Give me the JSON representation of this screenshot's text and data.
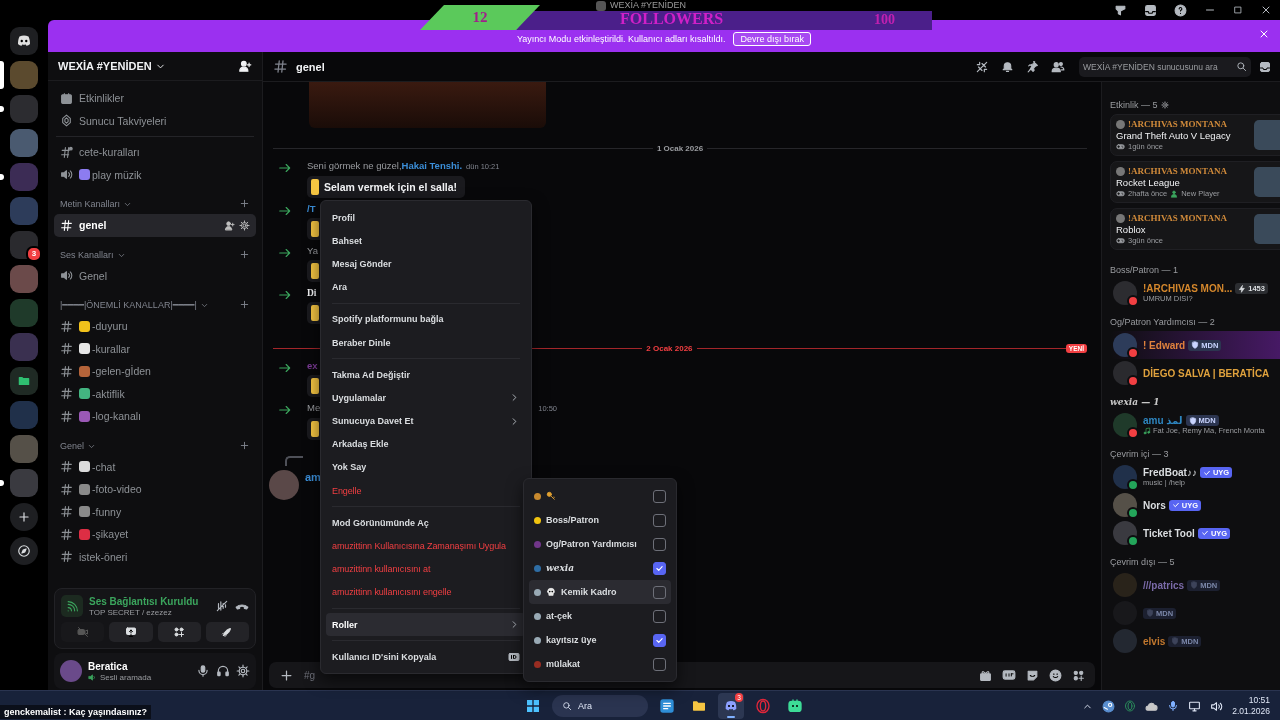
{
  "window": {
    "title": "WEXİA #YENİDEN"
  },
  "stream_overlay": {
    "left_count": "12",
    "label": "FOLLOWERS",
    "right_count": "100",
    "chat_line": "genckemalist : Kaç yaşındasınız?"
  },
  "banner": {
    "text": "Yayıncı Modu etkinleştirildi. Kullanıcı adları kısaltıldı.",
    "button": "Devre dışı bırak"
  },
  "server_rail": [
    {
      "kind": "home",
      "selected": false,
      "unread": false
    },
    {
      "kind": "server",
      "selected": true,
      "unread": false
    },
    {
      "kind": "server",
      "selected": false,
      "unread": true
    },
    {
      "kind": "server",
      "selected": false,
      "unread": false
    },
    {
      "kind": "server",
      "selected": false,
      "unread": true
    },
    {
      "kind": "server",
      "selected": false,
      "unread": false
    },
    {
      "kind": "server",
      "selected": false,
      "unread": false,
      "badge": "3"
    },
    {
      "kind": "server",
      "selected": false,
      "unread": false
    },
    {
      "kind": "server",
      "selected": false,
      "unread": false
    },
    {
      "kind": "server",
      "selected": false,
      "unread": false
    },
    {
      "kind": "folder",
      "selected": false,
      "unread": false
    },
    {
      "kind": "server",
      "selected": false,
      "unread": false
    },
    {
      "kind": "server",
      "selected": false,
      "unread": false
    },
    {
      "kind": "server",
      "selected": false,
      "unread": true
    },
    {
      "kind": "add",
      "selected": false,
      "unread": false
    },
    {
      "kind": "discover",
      "selected": false,
      "unread": false
    }
  ],
  "sidebar": {
    "server_name": "WEXİA #YENİDEN",
    "shortcuts": [
      {
        "kind": "events",
        "label": "Etkinlikler"
      },
      {
        "kind": "boosts",
        "label": "Sunucu Takviyeleri"
      }
    ],
    "channels": [
      {
        "kind": "rules",
        "label": "cete-kuralları",
        "selected": false
      },
      {
        "kind": "voice",
        "label": "play müzik",
        "color": "#8c7cf0",
        "selected": false
      }
    ],
    "categories": [
      {
        "label": "Metin Kanalları",
        "channels": [
          {
            "kind": "text",
            "label": "genel",
            "selected": true
          }
        ]
      },
      {
        "label": "Ses Kanalları",
        "channels": [
          {
            "kind": "voice",
            "label": "Genel",
            "selected": false
          }
        ]
      },
      {
        "label": "|━━━━|ÖNEMLİ KANALLAR|━━━━|",
        "channels": [
          {
            "kind": "text",
            "label": "-duyuru",
            "color": "#f2c21b",
            "selected": false
          },
          {
            "kind": "text",
            "label": "-kurallar",
            "color": "#e6e6e6",
            "selected": false
          },
          {
            "kind": "text",
            "label": "-gelen-gİden",
            "color": "#b5643a",
            "selected": false
          },
          {
            "kind": "text",
            "label": "-aktiflik",
            "color": "#43b581",
            "selected": false
          },
          {
            "kind": "text",
            "label": "-log-kanalı",
            "color": "#9b59b6",
            "selected": false
          }
        ]
      },
      {
        "label": "Genel",
        "channels": [
          {
            "kind": "text",
            "label": "-chat",
            "color": "#dcdcdc",
            "selected": false
          },
          {
            "kind": "text",
            "label": "-foto-video",
            "color": "#8a8a8a",
            "selected": false
          },
          {
            "kind": "text",
            "label": "-funny",
            "color": "#8a8a8a",
            "selected": false
          },
          {
            "kind": "text",
            "label": "-şikayet",
            "color": "#dd2e44",
            "selected": false
          },
          {
            "kind": "text",
            "label": "istek-öneri",
            "selected": false
          }
        ]
      }
    ]
  },
  "voice_panel": {
    "status": "Ses Bağlantısı Kuruldu",
    "channel": "TOP SECRET / ezezez"
  },
  "user_panel": {
    "name": "Beratica",
    "status": "Sesli aramada"
  },
  "chat": {
    "channel": "genel",
    "search_placeholder": "WEXİA #YENİDEN sunucusunu ara",
    "composer_placeholder": "#g",
    "messages": [
      {
        "kind": "image"
      },
      {
        "kind": "date",
        "label": "1 Ocak 2026",
        "new": false
      },
      {
        "kind": "join",
        "text": "Seni görmek ne güzel, ",
        "mention": "Hakai Tenshi.",
        "color": "#3b8ed8",
        "time": "dün 10:21",
        "button": "Selam vermek için el salla!"
      },
      {
        "kind": "join",
        "mention": "/T",
        "color": "#3b8ed8"
      },
      {
        "kind": "join",
        "text": "Ya",
        "bold": false
      },
      {
        "kind": "join",
        "text": "Di",
        "bold": true
      },
      {
        "kind": "date",
        "label": "2 Ocak 2026",
        "new": true,
        "badge": "YENİ"
      },
      {
        "kind": "join",
        "mention": "ex",
        "color": "#7d3c98"
      },
      {
        "kind": "join",
        "text": "Me",
        "bold": false,
        "time": "10:50"
      },
      {
        "kind": "reply",
        "mention": "am",
        "color": "#3b8ed8"
      }
    ]
  },
  "context_menu": [
    {
      "kind": "item",
      "label": "Profil",
      "selected": false
    },
    {
      "kind": "item",
      "label": "Bahset",
      "selected": false
    },
    {
      "kind": "item",
      "label": "Mesaj Gönder",
      "selected": false
    },
    {
      "kind": "item",
      "label": "Ara",
      "selected": false
    },
    {
      "kind": "separator"
    },
    {
      "kind": "item",
      "label": "Spotify platformunu bağla",
      "selected": false
    },
    {
      "kind": "item",
      "label": "Beraber Dinle",
      "selected": false
    },
    {
      "kind": "separator"
    },
    {
      "kind": "item",
      "label": "Takma Ad Değiştir",
      "selected": false
    },
    {
      "kind": "submenu",
      "label": "Uygulamalar",
      "selected": false
    },
    {
      "kind": "submenu",
      "label": "Sunucuya Davet Et",
      "selected": false
    },
    {
      "kind": "item",
      "label": "Arkadaş Ekle",
      "selected": false
    },
    {
      "kind": "item",
      "label": "Yok Say",
      "selected": false
    },
    {
      "kind": "danger",
      "label": "Engelle",
      "selected": false
    },
    {
      "kind": "separator"
    },
    {
      "kind": "item",
      "label": "Mod Görünümünde Aç",
      "selected": false
    },
    {
      "kind": "danger",
      "label": "amuzittinn Kullanıcısına Zamanaşımı Uygula",
      "selected": false
    },
    {
      "kind": "danger",
      "label": "amuzittinn kullanıcısını at",
      "selected": false
    },
    {
      "kind": "danger",
      "label": "amuzittinn kullanıcısını engelle",
      "selected": false
    },
    {
      "kind": "separator"
    },
    {
      "kind": "submenu",
      "label": "Roller",
      "selected": true
    },
    {
      "kind": "separator"
    },
    {
      "kind": "copy_id",
      "label": "Kullanıcı ID'sini Kopyala",
      "selected": false
    }
  ],
  "roles_menu": [
    {
      "kind": "icon",
      "color": "#c7892e",
      "checked": false,
      "selected": false
    },
    {
      "kind": "text",
      "label": "Boss/Patron",
      "color": "#f1c40f",
      "checked": false,
      "selected": false
    },
    {
      "kind": "text",
      "label": "Og/Patron Yardımcısı",
      "color": "#71368a",
      "checked": false,
      "selected": false
    },
    {
      "kind": "fancy",
      "label": "wexia",
      "color": "#2e6da4",
      "checked": true,
      "selected": false
    },
    {
      "kind": "icon_text",
      "label": "Kemik Kadro",
      "color": "#99aab5",
      "checked": false,
      "selected": true
    },
    {
      "kind": "text",
      "label": "at-çek",
      "color": "#99aab5",
      "checked": false,
      "selected": false
    },
    {
      "kind": "text",
      "label": "kayıtsız üye",
      "color": "#99aab5",
      "checked": true,
      "selected": false
    },
    {
      "kind": "text",
      "label": "mülakat",
      "color": "#992d22",
      "checked": false,
      "selected": false
    }
  ],
  "members": {
    "activity_title": "Etkinlik — 5",
    "activities": [
      {
        "user": "!ARCHIVAS MONTANA",
        "game": "Grand Theft Auto V Legacy",
        "time": "1gün önce"
      },
      {
        "user": "!ARCHIVAS MONTANA",
        "game": "Rocket League",
        "time": "2hafta önce",
        "detail": "New Player"
      },
      {
        "user": "!ARCHIVAS MONTANA",
        "game": "Roblox",
        "time": "3gün önce"
      }
    ],
    "groups": [
      {
        "label": "Boss/Patron — 1",
        "fancy": false,
        "members": [
          {
            "kind": "dnd",
            "name": "!ARCHIVAS MON...",
            "color": "#d4872c",
            "banner": false,
            "subtitle": {
              "kind": "custom",
              "text": "UMRUM DISI?"
            },
            "badge": {
              "kind": "boost",
              "label": "1453"
            }
          }
        ]
      },
      {
        "label": "Og/Patron Yardımcısı — 2",
        "fancy": false,
        "members": [
          {
            "kind": "dnd",
            "name": "! Edward",
            "color": "#e0823d",
            "banner": true,
            "badge": {
              "kind": "mod",
              "label": "MDN"
            }
          },
          {
            "kind": "dnd",
            "name": "DİEGO SALVA | BERATİCA",
            "color": "#e0a23d",
            "banner": false
          }
        ]
      },
      {
        "label": "wexia — 1",
        "fancy": true,
        "members": [
          {
            "kind": "dnd",
            "name": "amu لمذ",
            "color": "#2e86c1",
            "banner": false,
            "subtitle": {
              "kind": "listening",
              "text": "Fat Joe, Remy Ma, French Monta"
            },
            "badge": {
              "kind": "mod",
              "label": "MDN"
            }
          }
        ]
      },
      {
        "label": "Çevrim içi — 3",
        "fancy": false,
        "members": [
          {
            "kind": "online",
            "name": "FredBoat♪♪",
            "color": "#dbdee1",
            "banner": false,
            "subtitle": {
              "kind": "custom",
              "text": "music | /help"
            },
            "badge": {
              "kind": "app",
              "label": "UYG"
            }
          },
          {
            "kind": "online",
            "name": "Nors",
            "color": "#dbdee1",
            "banner": false,
            "badge": {
              "kind": "app",
              "label": "UYG"
            }
          },
          {
            "kind": "online",
            "name": "Ticket Tool",
            "color": "#dbdee1",
            "banner": false,
            "badge": {
              "kind": "app",
              "label": "UYG"
            }
          }
        ]
      },
      {
        "label": "Çevrim dışı — 5",
        "fancy": false,
        "members": [
          {
            "kind": "offline",
            "name": "///patrics",
            "color": "#7a6aa8",
            "banner": false,
            "badge": {
              "kind": "mod",
              "label": "MDN"
            }
          },
          {
            "kind": "offline",
            "banner": false,
            "badge": {
              "kind": "mod",
              "label": "MDN"
            }
          },
          {
            "kind": "offline",
            "name": "elvis",
            "color": "#c2782e",
            "banner": false,
            "badge": {
              "kind": "mod",
              "label": "MDN"
            }
          }
        ]
      }
    ]
  },
  "taskbar": {
    "search": "Ara",
    "apps": [
      {
        "kind": "widgets",
        "selected": false
      },
      {
        "kind": "folder",
        "selected": false
      },
      {
        "kind": "discord",
        "selected": true,
        "badge": "3"
      },
      {
        "kind": "opera",
        "selected": false
      },
      {
        "kind": "app",
        "selected": false
      }
    ],
    "time": "10:51",
    "date": "2.01.2026"
  }
}
